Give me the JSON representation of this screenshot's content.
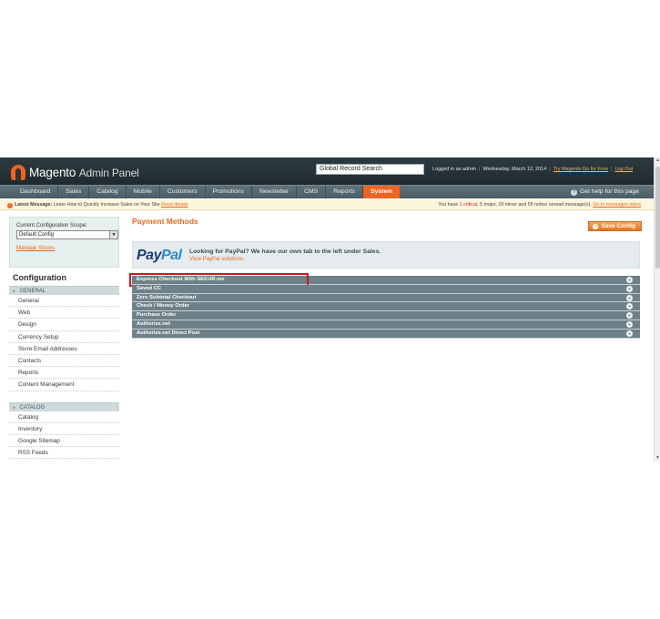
{
  "header": {
    "logo_name": "Magento",
    "logo_suffix": "Admin Panel",
    "search_value": "Global Record Search",
    "logged_in": "Logged in as admin",
    "date": "Wednesday, March 12, 2014",
    "try_link": "Try Magento Go for Free",
    "logout": "Log Out"
  },
  "nav": {
    "items": [
      "Dashboard",
      "Sales",
      "Catalog",
      "Mobile",
      "Customers",
      "Promotions",
      "Newsletter",
      "CMS",
      "Reports",
      "System"
    ],
    "active_index": 9,
    "help": "Get help for this page"
  },
  "message_bar": {
    "label": "Latest Message:",
    "text": "Learn How to Quickly Increase Sales on Your Site",
    "read_details": "Read details",
    "summary_prefix": "You have",
    "critical": "1 critical",
    "summary_rest": ", 5 major, 19 minor and 55 notice unread message(s).",
    "inbox_link": "Go to messages inbox"
  },
  "sidebar": {
    "scope_label": "Current Configuration Scope:",
    "scope_value": "Default Config",
    "manage_stores": "Manage Stores",
    "config_title": "Configuration",
    "general_label": "GENERAL",
    "general_items": [
      "General",
      "Web",
      "Design",
      "Currency Setup",
      "Store Email Addresses",
      "Contacts",
      "Reports",
      "Content Management"
    ],
    "catalog_label": "CATALOG",
    "catalog_items": [
      "Catalog",
      "Inventory",
      "Google Sitemap",
      "RSS Feeds"
    ]
  },
  "main": {
    "title": "Payment Methods",
    "save_label": "Save Config",
    "paypal_logo_a": "Pay",
    "paypal_logo_b": "Pal",
    "paypal_heading": "Looking for PayPal? We have our own tab to the left under Sales.",
    "paypal_link": "View PayPal solutions.",
    "methods": [
      "Express Checkout With SEKUR.me",
      "Saved CC",
      "Zero Subtotal Checkout",
      "Check / Money Order",
      "Purchase Order",
      "Authorize.net",
      "Authorize.net Direct Post"
    ],
    "highlighted_index": 0
  },
  "colors": {
    "accent": "#f26322",
    "highlight": "#d1171c",
    "section_bar": "#6e8189"
  }
}
